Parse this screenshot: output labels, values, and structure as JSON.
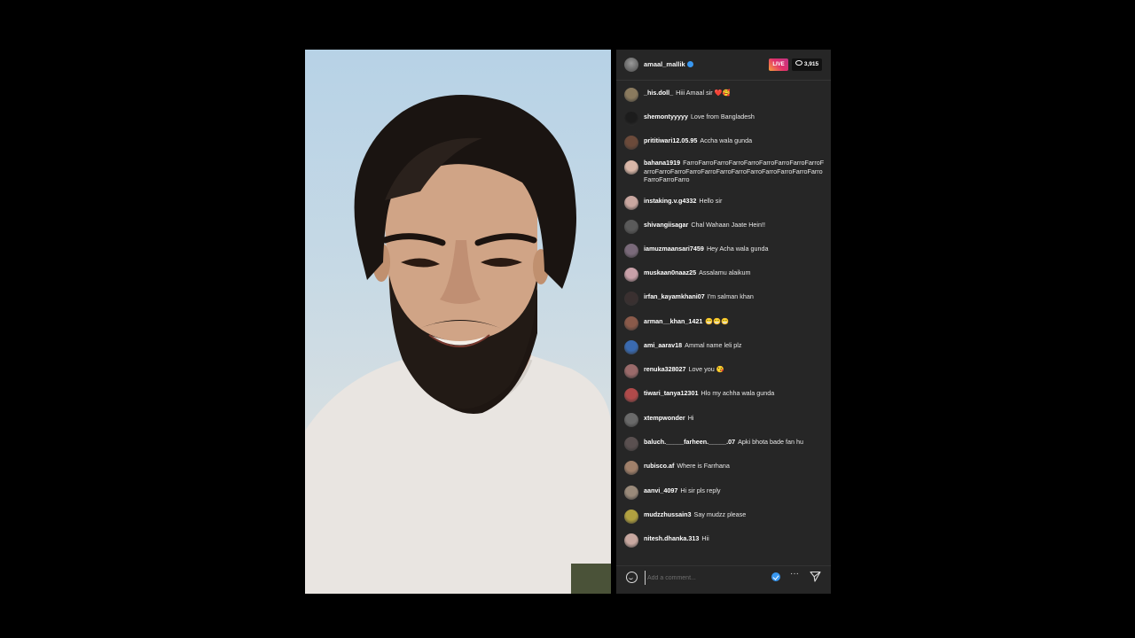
{
  "stream": {
    "host": "amaal_mallik",
    "live_label": "LIVE",
    "viewer_count": "3,915"
  },
  "comments": [
    {
      "user": "_his.doll_",
      "text": "Hiii Amaal sir ❤️🥰",
      "avatar_color": "#8a7a5e"
    },
    {
      "user": "shemontyyyyy",
      "text": "Love from Bangladesh",
      "avatar_color": "#1c1c1c"
    },
    {
      "user": "prititiwari12.05.95",
      "text": "Accha wala gunda",
      "avatar_color": "#6b4a3a"
    },
    {
      "user": "bahana1919",
      "text": "FarroFarroFarroFarroFarroFarroFarroFarroFarroFarroFarroFarroFarroFarroFarroFarroFarroFarroFarroFarroFarroFarroFarroFarro",
      "avatar_color": "#d9b7a8"
    },
    {
      "user": "instaking.v.g4332",
      "text": "Hello sir",
      "avatar_color": "#c9a7a0"
    },
    {
      "user": "shivangiisagar",
      "text": "Chal Wahaan Jaate Hein!!",
      "avatar_color": "#5a5a5a"
    },
    {
      "user": "iamuzmaansari7459",
      "text": "Hey Acha wala gunda",
      "avatar_color": "#7a6a7a"
    },
    {
      "user": "muskaan0naaz25",
      "text": "Assalamu alaikum",
      "avatar_color": "#c8a0a8"
    },
    {
      "user": "irfan_kayamkhani07",
      "text": "I'm salman khan",
      "avatar_color": "#3a3030"
    },
    {
      "user": "arman__khan_1421",
      "text": "😁😁😁",
      "avatar_color": "#8a5a4a"
    },
    {
      "user": "ami_aarav18",
      "text": "Ammal name leli plz",
      "avatar_color": "#3a6ab0"
    },
    {
      "user": "renuka328027",
      "text": "Love you 😘",
      "avatar_color": "#9a6a6a"
    },
    {
      "user": "tiwari_tanya12301",
      "text": "Hlo my achha wala gunda",
      "avatar_color": "#b04a4a"
    },
    {
      "user": "xtempwonder",
      "text": "Hi",
      "avatar_color": "#6a6a6a"
    },
    {
      "user": "baluch._____farheen._____.07",
      "text": "Apki bhota bade fan hu",
      "avatar_color": "#5a5050"
    },
    {
      "user": "rubisco.af",
      "text": "Where is Farrhana",
      "avatar_color": "#a0806a"
    },
    {
      "user": "aanvi_4097",
      "text": "Hi sir pls reply",
      "avatar_color": "#9a8a7a"
    },
    {
      "user": "mudzzhussain3",
      "text": "Say mudzz please",
      "avatar_color": "#b0a040"
    },
    {
      "user": "nitesh.dhanka.313",
      "text": "Hii",
      "avatar_color": "#c8a8a0"
    }
  ],
  "composer": {
    "placeholder": "Add a comment..."
  },
  "icons": {
    "emoji": "emoji-icon",
    "verified": "verified-badge-icon",
    "more": "more-icon",
    "send": "send-icon",
    "viewers": "eye-icon"
  }
}
